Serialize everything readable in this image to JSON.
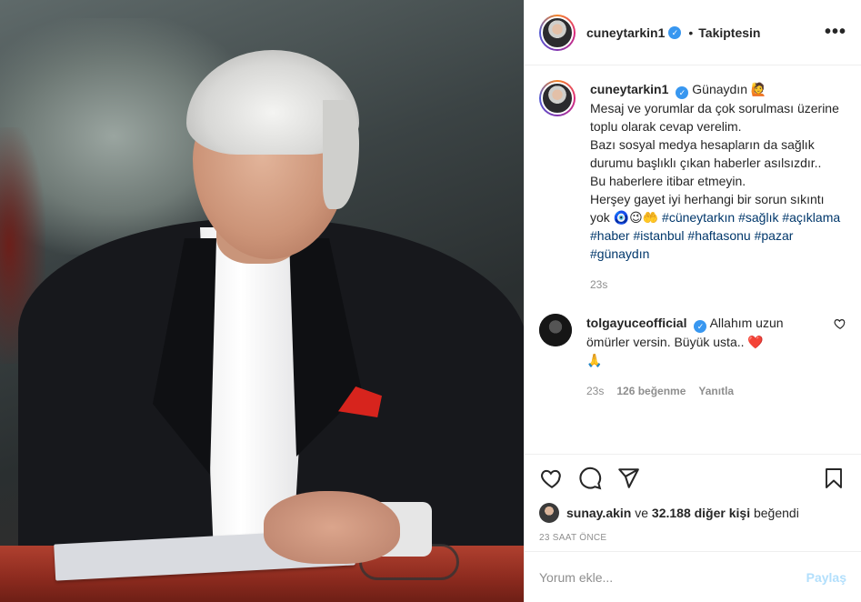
{
  "header": {
    "username": "cuneytarkin1",
    "separator": "•",
    "follow_status": "Takiptesin",
    "more_icon": "more-horizontal-icon"
  },
  "caption": {
    "username": "cuneytarkin1",
    "text": "Günaydın 🙋\nMesaj ve yorumlar da çok sorulması üzerine toplu olarak cevap verelim.\nBazı sosyal medya hesapların da sağlık durumu başlıklı çıkan haberler asılsızdır..\nBu haberlere itibar etmeyin.\nHerşey gayet iyi herhangi bir sorun sıkıntı yok 🧿😉🤲 ",
    "hashtags": [
      "#cüneytarkın",
      "#sağlık",
      "#açıklama",
      "#haber",
      "#istanbul",
      "#haftasonu",
      "#pazar",
      "#günaydın"
    ],
    "time": "23s"
  },
  "comments": [
    {
      "username": "tolgayuceofficial",
      "text": "Allahım uzun ömürler versin. Büyük usta.. ❤️\n🙏",
      "time": "23s",
      "likes": "126 beğenme",
      "reply_label": "Yanıtla"
    }
  ],
  "actions": {
    "like_icon": "heart-icon",
    "comment_icon": "comment-icon",
    "share_icon": "paper-plane-icon",
    "save_icon": "bookmark-icon"
  },
  "likes": {
    "first_liker": "sunay.akin",
    "connector": "ve",
    "others": "32.188 diğer kişi",
    "suffix": "beğendi"
  },
  "timestamp": "23 SAAT ÖNCE",
  "add_comment": {
    "placeholder": "Yorum ekle...",
    "post_label": "Paylaş"
  },
  "colors": {
    "link": "#00376b",
    "verified": "#3897f0",
    "post_button_disabled": "#b2dffc",
    "muted": "#8e8e8e"
  }
}
